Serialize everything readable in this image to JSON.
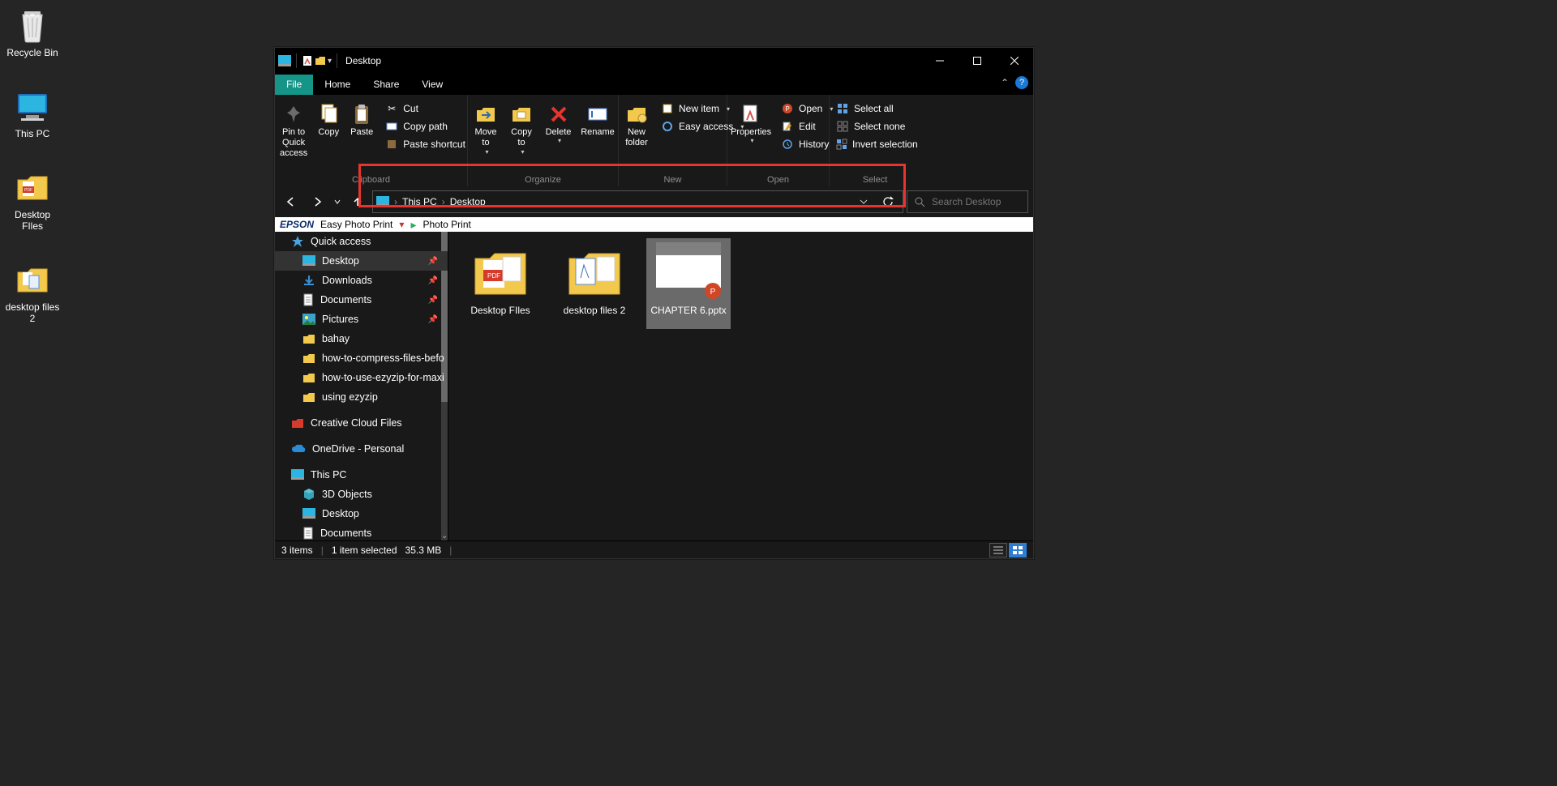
{
  "desktop_icons": [
    {
      "name": "recycle-bin",
      "label": "Recycle Bin"
    },
    {
      "name": "this-pc",
      "label": "This PC"
    },
    {
      "name": "desktop-files",
      "label": "Desktop FIles"
    },
    {
      "name": "desktop-files-2",
      "label": "desktop files 2"
    }
  ],
  "window": {
    "title": "Desktop",
    "tabs": {
      "file": "File",
      "home": "Home",
      "share": "Share",
      "view": "View"
    },
    "ribbon": {
      "pin": "Pin to Quick access",
      "copy": "Copy",
      "paste": "Paste",
      "cut": "Cut",
      "copy_path": "Copy path",
      "paste_shortcut": "Paste shortcut",
      "move_to": "Move to",
      "copy_to": "Copy to",
      "delete": "Delete",
      "rename": "Rename",
      "new_folder": "New folder",
      "new_item": "New item",
      "easy_access": "Easy access",
      "properties": "Properties",
      "open": "Open",
      "edit": "Edit",
      "history": "History",
      "select_all": "Select all",
      "select_none": "Select none",
      "invert_selection": "Invert selection",
      "g_clipboard": "Clipboard",
      "g_organize": "Organize",
      "g_new": "New",
      "g_open": "Open",
      "g_select": "Select"
    },
    "breadcrumb": [
      "This PC",
      "Desktop"
    ],
    "search_placeholder": "Search Desktop",
    "epson": {
      "brand": "EPSON",
      "a": "Easy Photo Print",
      "b": "Photo Print"
    },
    "navpane": [
      {
        "d": 0,
        "icon": "star",
        "label": "Quick access",
        "sel": false,
        "pin": false
      },
      {
        "d": 1,
        "icon": "desktop",
        "label": "Desktop",
        "sel": true,
        "pin": true
      },
      {
        "d": 1,
        "icon": "download",
        "label": "Downloads",
        "sel": false,
        "pin": true
      },
      {
        "d": 1,
        "icon": "doc",
        "label": "Documents",
        "sel": false,
        "pin": true
      },
      {
        "d": 1,
        "icon": "pic",
        "label": "Pictures",
        "sel": false,
        "pin": true
      },
      {
        "d": 1,
        "icon": "folder",
        "label": "bahay",
        "sel": false,
        "pin": false
      },
      {
        "d": 1,
        "icon": "folder",
        "label": "how-to-compress-files-befo",
        "sel": false,
        "pin": false
      },
      {
        "d": 1,
        "icon": "folder",
        "label": "how-to-use-ezyzip-for-maxi",
        "sel": false,
        "pin": false
      },
      {
        "d": 1,
        "icon": "folder",
        "label": "using ezyzip",
        "sel": false,
        "pin": false
      },
      {
        "d": 0,
        "icon": "cc",
        "label": "Creative Cloud Files",
        "sel": false,
        "pin": false,
        "gap": true
      },
      {
        "d": 0,
        "icon": "onedrive",
        "label": "OneDrive - Personal",
        "sel": false,
        "pin": false,
        "gap": true
      },
      {
        "d": 0,
        "icon": "pc",
        "label": "This PC",
        "sel": false,
        "pin": false,
        "gap": true
      },
      {
        "d": 1,
        "icon": "3d",
        "label": "3D Objects",
        "sel": false,
        "pin": false
      },
      {
        "d": 1,
        "icon": "desktop",
        "label": "Desktop",
        "sel": false,
        "pin": false
      },
      {
        "d": 1,
        "icon": "doc",
        "label": "Documents",
        "sel": false,
        "pin": false
      }
    ],
    "items": [
      {
        "label": "Desktop FIles",
        "kind": "folder-pdf",
        "sel": false
      },
      {
        "label": "desktop files 2",
        "kind": "folder-mixed",
        "sel": false
      },
      {
        "label": "CHAPTER 6.pptx",
        "kind": "pptx",
        "sel": true
      }
    ],
    "status": {
      "count": "3 items",
      "selected": "1 item selected",
      "size": "35.3 MB"
    }
  }
}
